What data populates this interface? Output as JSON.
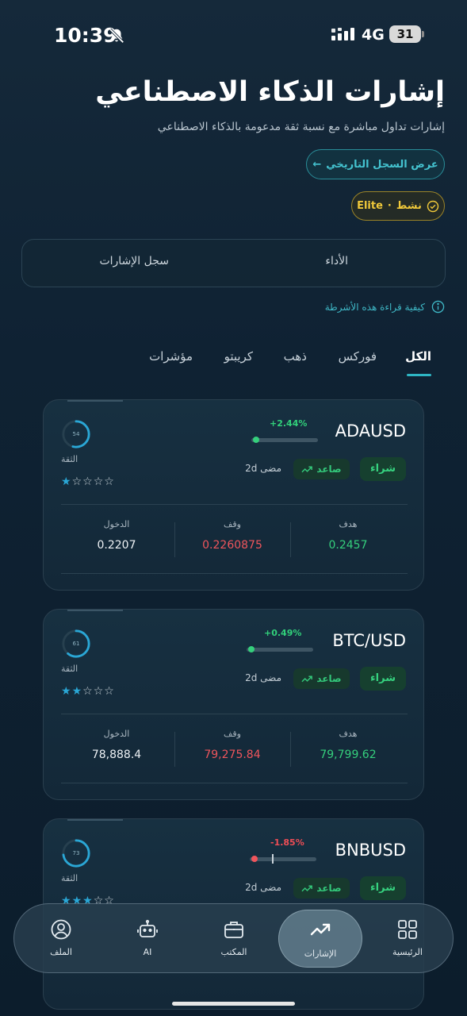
{
  "status_bar": {
    "time": "10:39",
    "network": "4G",
    "battery": "31"
  },
  "header": {
    "title": "إشارات الذكاء الاصطناعي",
    "subtitle": "إشارات تداول مباشرة مع نسبة ثقة مدعومة بالذكاء الاصطناعي",
    "history_button": "عرض السجل التاريخي",
    "history_arrow": "←",
    "badge_status": "نشط",
    "badge_sep": "·",
    "badge_plan": "Elite"
  },
  "view_toggle": {
    "performance": "الأداء",
    "signal_log": "سجل الإشارات"
  },
  "help_text": "كيفية قراءة هذه الأشرطة",
  "tabs": [
    {
      "label": "الكل",
      "active": true
    },
    {
      "label": "فوركس",
      "active": false
    },
    {
      "label": "ذهب",
      "active": false
    },
    {
      "label": "كريبتو",
      "active": false
    },
    {
      "label": "مؤشرات",
      "active": false
    }
  ],
  "card_labels": {
    "confidence": "الثقة",
    "buy": "شراء",
    "direction": "صاعد",
    "target": "هدف",
    "stop": "وقف",
    "entry": "الدخول"
  },
  "signals": [
    {
      "symbol": "ADAUSD",
      "change": "+2.44%",
      "trend": "up",
      "confidence": "54",
      "confidence_value": 54,
      "stars": 1,
      "ago": "مضى 2d",
      "target": "0.2457",
      "stop": "0.2260875",
      "entry": "0.2207",
      "progress": 0.02
    },
    {
      "symbol": "BTC/USD",
      "change": "+0.49%",
      "trend": "up",
      "confidence": "61",
      "confidence_value": 61,
      "stars": 2,
      "ago": "مضى 2d",
      "target": "79,799.62",
      "stop": "79,275.84",
      "entry": "78,888.4",
      "progress": 0.02
    },
    {
      "symbol": "BNBUSD",
      "change": "-1.85%",
      "trend": "down",
      "confidence": "73",
      "confidence_value": 73,
      "stars": 3,
      "ago": "مضى 2d",
      "progress": 0.02
    }
  ],
  "colors": {
    "accent": "#2eb6c4",
    "positive": "#35cf7c",
    "negative": "#ef555c",
    "gold": "#f1c93a"
  },
  "bottom_nav": [
    {
      "label": "الرئيسية",
      "icon": "grid-icon"
    },
    {
      "label": "الإشارات",
      "icon": "trending-up-icon",
      "active": true
    },
    {
      "label": "المكتب",
      "icon": "briefcase-icon"
    },
    {
      "label": "AI",
      "icon": "robot-icon"
    },
    {
      "label": "الملف",
      "icon": "user-icon"
    }
  ]
}
